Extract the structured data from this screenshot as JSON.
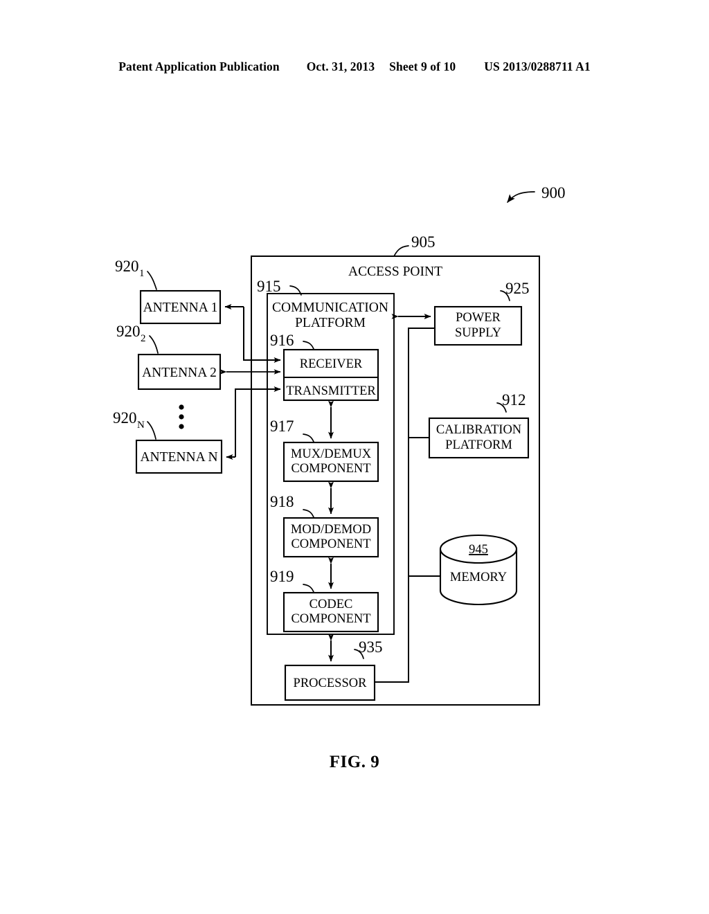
{
  "header": {
    "left": "Patent Application Publication",
    "date": "Oct. 31, 2013",
    "sheet": "Sheet 9 of 10",
    "patent_number": "US 2013/0288711 A1"
  },
  "figure": {
    "caption": "FIG. 9",
    "system_ref": "900",
    "access_point": {
      "title": "ACCESS POINT",
      "ref": "905"
    },
    "communication_platform": {
      "label_line1": "COMMUNICATION",
      "label_line2": "PLATFORM",
      "ref": "915"
    },
    "antennas": [
      {
        "label": "ANTENNA 1",
        "ref": "920",
        "sub": "1"
      },
      {
        "label": "ANTENNA 2",
        "ref": "920",
        "sub": "2"
      },
      {
        "label": "ANTENNA N",
        "ref": "920",
        "sub": "N"
      }
    ],
    "ellipsis_symbol": "vertical-ellipsis",
    "blocks": [
      {
        "id": "receiver",
        "label": "RECEIVER",
        "ref": "916"
      },
      {
        "id": "transmitter",
        "label": "TRANSMITTER",
        "ref": ""
      },
      {
        "id": "mux_demux",
        "label_line1": "MUX/DEMUX",
        "label_line2": "COMPONENT",
        "ref": "917"
      },
      {
        "id": "mod_demod",
        "label_line1": "MOD/DEMOD",
        "label_line2": "COMPONENT",
        "ref": "918"
      },
      {
        "id": "codec",
        "label_line1": "CODEC",
        "label_line2": "COMPONENT",
        "ref": "919"
      },
      {
        "id": "processor",
        "label": "PROCESSOR",
        "ref": "935"
      },
      {
        "id": "power_supply",
        "label_line1": "POWER",
        "label_line2": "SUPPLY",
        "ref": "925"
      },
      {
        "id": "calibration",
        "label_line1": "CALIBRATION",
        "label_line2": "PLATFORM",
        "ref": "912"
      },
      {
        "id": "memory",
        "label": "MEMORY",
        "ref": "945"
      }
    ]
  }
}
